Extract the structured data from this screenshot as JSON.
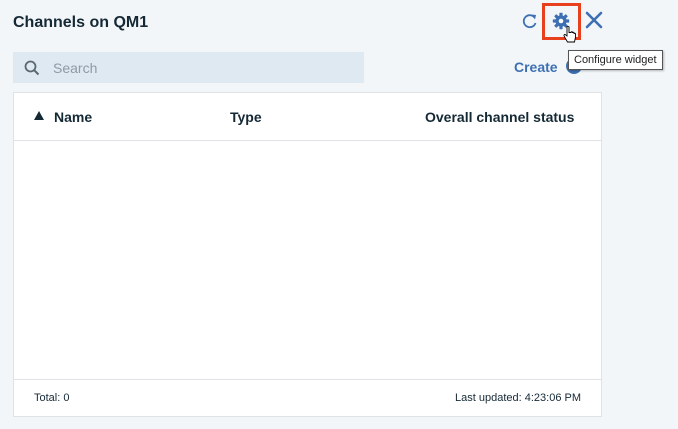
{
  "widget": {
    "title": "Channels on QM1"
  },
  "toolbar": {
    "refresh_icon": "refresh-icon",
    "configure_icon": "gear-icon",
    "close_icon": "close-icon",
    "tooltip": "Configure widget",
    "highlight_color": "#e8401c"
  },
  "search": {
    "placeholder": "Search",
    "value": ""
  },
  "actions": {
    "create_label": "Create"
  },
  "table": {
    "columns": [
      {
        "label": "Name",
        "sorted": "ascending"
      },
      {
        "label": "Type"
      },
      {
        "label": "Overall channel status"
      }
    ],
    "rows": []
  },
  "footer": {
    "total": "Total: 0",
    "last_updated": "Last updated: 4:23:06 PM"
  },
  "colors": {
    "accent": "#3d70b2",
    "background": "#f3f6f9"
  }
}
